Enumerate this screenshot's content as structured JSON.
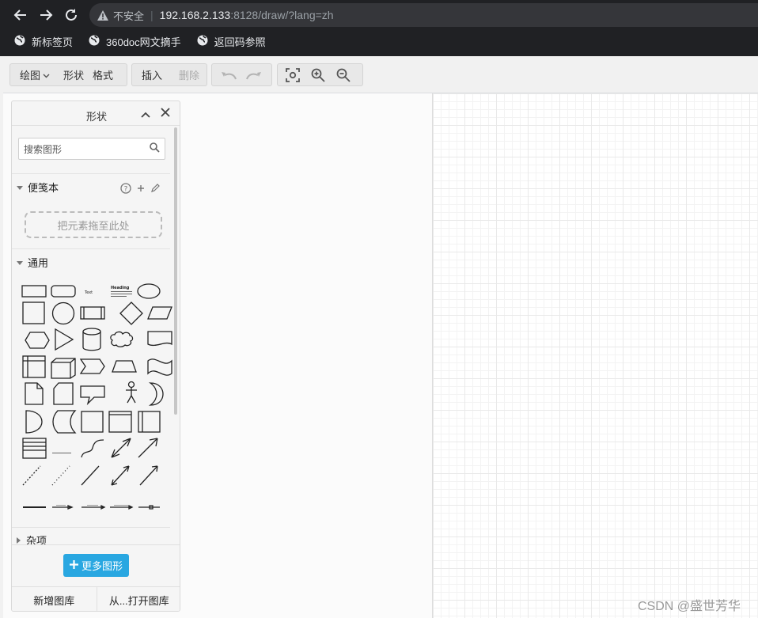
{
  "browser": {
    "insecure_label": "不安全",
    "url_host": "192.168.2.133",
    "url_rest": ":8128/draw/?lang=zh",
    "bookmarks": [
      {
        "label": "新标签页",
        "icon": "globe-icon"
      },
      {
        "label": "360doc网文摘手",
        "icon": "globe-icon"
      },
      {
        "label": "返回码参照",
        "icon": "globe-icon"
      }
    ]
  },
  "toolbar": {
    "draw_label": "绘图",
    "shape_label": "形状",
    "format_label": "格式",
    "insert_label": "插入",
    "delete_label": "删除"
  },
  "panel": {
    "title": "形状",
    "search_placeholder": "搜索图形",
    "scratchpad_label": "便笺本",
    "dropzone_label": "把元素拖至此处",
    "general_label": "通用",
    "misc_label": "杂项",
    "more_shapes_label": "更多图形",
    "new_library_label": "新增图库",
    "open_library_label": "从...打开图库",
    "shape_text_label": "Text",
    "shape_heading_label": "Heading"
  },
  "watermark": "CSDN @盛世芳华",
  "colors": {
    "accent": "#29a7e1",
    "chrome": "#202124"
  }
}
